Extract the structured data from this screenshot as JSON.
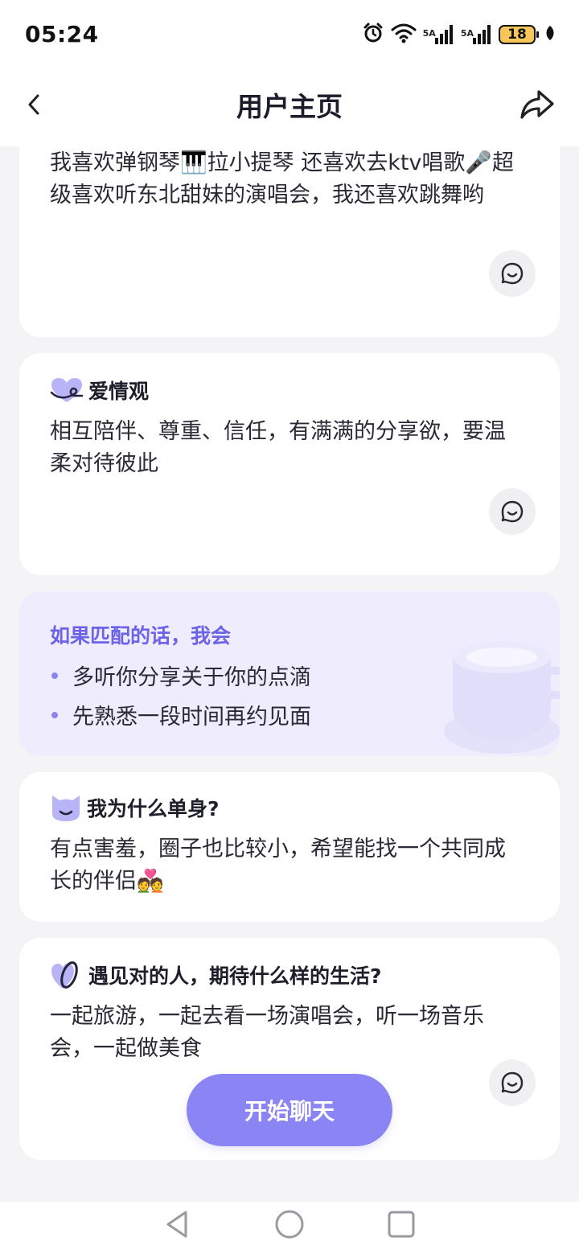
{
  "status_bar": {
    "time": "05:24",
    "alarm_icon": "alarm-clock-icon",
    "wifi_icon": "wifi-icon",
    "signal_1_label": "5A",
    "signal_2_label": "5A",
    "battery_level": "18",
    "battery_saver_icon": "leaf-icon"
  },
  "header": {
    "back_icon": "chevron-left-icon",
    "title": "用户主页",
    "share_icon": "share-arrow-icon"
  },
  "cards": {
    "hobbies": {
      "text": "我喜欢弹钢琴🎹拉小提琴 还喜欢去ktv唱歌🎤超级喜欢听东北甜妹的演唱会，我还喜欢跳舞哟",
      "reply_icon": "chat-bubble-icon"
    },
    "love_view": {
      "heading": "爱情观",
      "heading_icon": "heart-icon",
      "text": "相互陪伴、尊重、信任，有满满的分享欲，要温柔对待彼此",
      "reply_icon": "chat-bubble-icon"
    },
    "if_matched": {
      "title": "如果匹配的话，我会",
      "items": [
        "多听你分享关于你的点滴",
        "先熟悉一段时间再约见面"
      ],
      "decoration_icon": "coffee-cup-icon"
    },
    "why_single": {
      "heading": "我为什么单身?",
      "heading_icon": "cat-face-icon",
      "text": "有点害羞，圈子也比较小，希望能找一个共同成长的伴侣💑"
    },
    "ideal_life": {
      "heading": "遇见对的人，期待什么样的生活?",
      "heading_icon": "heart-ring-icon",
      "text": "一起旅游，一起去看一场演唱会，听一场音乐会，一起做美食",
      "reply_icon": "chat-bubble-icon"
    }
  },
  "start_chat_button": "开始聊天",
  "nav_bar": {
    "back_icon": "triangle-back-icon",
    "home_icon": "circle-home-icon",
    "recents_icon": "square-recents-icon"
  },
  "colors": {
    "accent": "#8a84f4",
    "accent_text": "#6c63e8",
    "match_card_bg": "#efedfd",
    "page_bg": "#f4f4f6"
  }
}
